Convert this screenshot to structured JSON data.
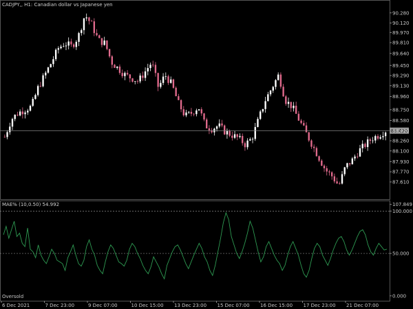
{
  "window": {
    "symbol_title": "CADJPY,, H1:  Canadian dollar vs Japanese yen",
    "indicator_title": "MAE% (10,0.50) 54.992",
    "oversold_label": "Oversold"
  },
  "colors": {
    "background": "#000000",
    "candle_up": "#ffffff",
    "candle_down": "#e06a8c",
    "indicator_line": "#2e9a52",
    "current_price_line": "#8a8a8a",
    "current_price_box": "#9a9a9a",
    "grid_dotted": "#8a8a8a"
  },
  "chart_data": [
    {
      "type": "candlestick",
      "title": "CADJPY,, H1:  Canadian dollar vs Japanese yen",
      "ylim": [
        87.36,
        90.44
      ],
      "y_tick_labels": [
        "90.280",
        "90.120",
        "89.970",
        "89.810",
        "89.640",
        "89.450",
        "89.290",
        "89.130",
        "88.960",
        "88.750",
        "88.580",
        "88.420",
        "88.260",
        "88.100",
        "87.930",
        "87.770",
        "87.610"
      ],
      "y_tick_values": [
        90.28,
        90.12,
        89.97,
        89.81,
        89.64,
        89.45,
        89.29,
        89.13,
        88.96,
        88.75,
        88.58,
        88.42,
        88.26,
        88.1,
        87.93,
        87.77,
        87.61
      ],
      "current_price": 88.42,
      "current_price_label": "88.420",
      "x_tick_labels": [
        "6 Dec 2021",
        "7 Dec 23:00",
        "9 Dec 07:00",
        "10 Dec 15:00",
        "13 Dec 23:00",
        "15 Dec 07:00",
        "16 Dec 15:00",
        "17 Dec 23:00",
        "21 Dec 07:00"
      ],
      "close_path": [
        88.32,
        88.6,
        88.7,
        88.75,
        88.8,
        89.1,
        89.3,
        89.5,
        89.72,
        89.8,
        89.75,
        89.9,
        90.25,
        90.1,
        89.85,
        89.8,
        89.5,
        89.4,
        89.3,
        89.25,
        89.2,
        89.35,
        89.5,
        89.1,
        89.3,
        89.15,
        88.85,
        88.65,
        88.7,
        88.8,
        88.5,
        88.45,
        88.5,
        88.4,
        88.35,
        88.3,
        88.2,
        88.3,
        88.6,
        88.9,
        89.1,
        89.3,
        88.9,
        88.8,
        88.6,
        88.4,
        88.2,
        88.0,
        87.8,
        87.7,
        87.55,
        87.85,
        87.95,
        88.1,
        88.2,
        88.3,
        88.35,
        88.42
      ],
      "ohlc_count": 150
    },
    {
      "type": "line",
      "title": "MAE% (10,0.50) 54.992",
      "ylim": [
        -5,
        110
      ],
      "y_tick_labels": [
        "107.849",
        "100.000",
        "50.000",
        "0.000"
      ],
      "y_tick_values": [
        107.849,
        100,
        50,
        0
      ],
      "levels": [
        100,
        50
      ],
      "current_value": 54.992,
      "values": [
        72,
        82,
        68,
        78,
        88,
        70,
        74,
        62,
        58,
        80,
        55,
        52,
        45,
        60,
        48,
        42,
        38,
        46,
        55,
        50,
        42,
        40,
        38,
        30,
        45,
        52,
        60,
        48,
        38,
        35,
        42,
        58,
        66,
        55,
        48,
        36,
        30,
        26,
        40,
        52,
        60,
        56,
        48,
        40,
        38,
        35,
        42,
        55,
        62,
        58,
        50,
        44,
        36,
        30,
        26,
        34,
        46,
        40,
        34,
        26,
        20,
        36,
        44,
        52,
        58,
        60,
        54,
        46,
        38,
        32,
        40,
        48,
        55,
        62,
        56,
        46,
        40,
        30,
        24,
        36,
        52,
        68,
        86,
        98,
        90,
        70,
        60,
        50,
        44,
        52,
        62,
        74,
        88,
        80,
        66,
        52,
        40,
        46,
        58,
        64,
        56,
        48,
        42,
        38,
        30,
        36,
        48,
        58,
        64,
        56,
        48,
        36,
        26,
        22,
        30,
        44,
        56,
        62,
        58,
        48,
        42,
        36,
        44,
        54,
        62,
        68,
        70,
        64,
        54,
        48,
        54,
        62,
        70,
        76,
        78,
        72,
        60,
        52,
        48,
        56,
        62,
        58,
        54,
        55
      ]
    }
  ]
}
